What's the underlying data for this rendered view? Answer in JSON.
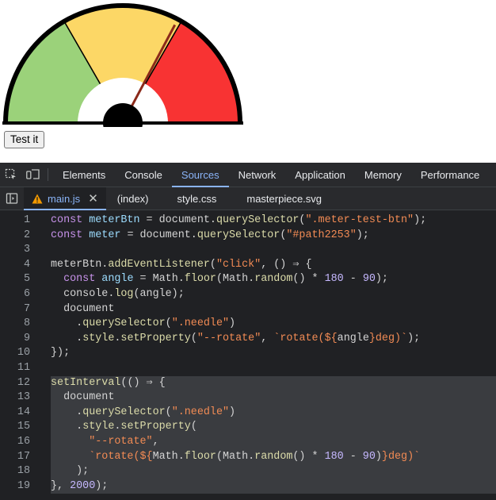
{
  "gauge": {
    "needle_angle_deg": 28,
    "colors": {
      "green": "#9bd27a",
      "yellow": "#fcd766",
      "red": "#f83333",
      "needle": "#8b2a1a",
      "outline": "#000000"
    }
  },
  "button": {
    "label": "Test it"
  },
  "devtools": {
    "tabs": [
      "Elements",
      "Console",
      "Sources",
      "Network",
      "Application",
      "Memory",
      "Performance"
    ],
    "active_tab": "Sources",
    "files": [
      "main.js",
      "(index)",
      "style.css",
      "masterpiece.svg"
    ],
    "active_file": "main.js",
    "line_numbers": [
      "1",
      "2",
      "3",
      "4",
      "5",
      "6",
      "7",
      "8",
      "9",
      "10",
      "11",
      "12",
      "13",
      "14",
      "15",
      "16",
      "17",
      "18",
      "19"
    ],
    "highlighted_lines": [
      12,
      13,
      14,
      15,
      16,
      17,
      18,
      19
    ]
  },
  "code": [
    [
      [
        "kw2",
        "const "
      ],
      [
        "vr",
        "meterBtn"
      ],
      [
        "pl",
        " = "
      ],
      [
        "pl",
        "document."
      ],
      [
        "fn",
        "querySelector"
      ],
      [
        "pl",
        "("
      ],
      [
        "st",
        "\".meter-test-btn\""
      ],
      [
        "pl",
        ");"
      ]
    ],
    [
      [
        "kw2",
        "const "
      ],
      [
        "vr",
        "meter"
      ],
      [
        "pl",
        " = "
      ],
      [
        "pl",
        "document."
      ],
      [
        "fn",
        "querySelector"
      ],
      [
        "pl",
        "("
      ],
      [
        "st",
        "\"#path2253\""
      ],
      [
        "pl",
        ");"
      ]
    ],
    [],
    [
      [
        "pl",
        "meterBtn."
      ],
      [
        "fn",
        "addEventListener"
      ],
      [
        "pl",
        "("
      ],
      [
        "st",
        "\"click\""
      ],
      [
        "pl",
        ", () ⇒ {"
      ]
    ],
    [
      [
        "pl",
        "  "
      ],
      [
        "kw2",
        "const "
      ],
      [
        "vr",
        "angle"
      ],
      [
        "pl",
        " = Math."
      ],
      [
        "fn",
        "floor"
      ],
      [
        "pl",
        "(Math."
      ],
      [
        "fn",
        "random"
      ],
      [
        "pl",
        "() "
      ],
      [
        "pl",
        "* "
      ],
      [
        "nm",
        "180"
      ],
      [
        "pl",
        " - "
      ],
      [
        "nm",
        "90"
      ],
      [
        "pl",
        ");"
      ]
    ],
    [
      [
        "pl",
        "  console."
      ],
      [
        "fn",
        "log"
      ],
      [
        "pl",
        "(angle);"
      ]
    ],
    [
      [
        "pl",
        "  document"
      ]
    ],
    [
      [
        "pl",
        "    ."
      ],
      [
        "fn",
        "querySelector"
      ],
      [
        "pl",
        "("
      ],
      [
        "st",
        "\".needle\""
      ],
      [
        "pl",
        ")"
      ]
    ],
    [
      [
        "pl",
        "    ."
      ],
      [
        "fn",
        "style"
      ],
      [
        "pl",
        "."
      ],
      [
        "fn",
        "setProperty"
      ],
      [
        "pl",
        "("
      ],
      [
        "st",
        "\"--rotate\""
      ],
      [
        "pl",
        ", "
      ],
      [
        "st",
        "`rotate(${"
      ],
      [
        "pl",
        "angle"
      ],
      [
        "st",
        "}deg)`"
      ],
      [
        "pl",
        ");"
      ]
    ],
    [
      [
        "pl",
        "});"
      ]
    ],
    [],
    [
      [
        "fn",
        "setInterval"
      ],
      [
        "pl",
        "(() ⇒ {"
      ]
    ],
    [
      [
        "pl",
        "  document"
      ]
    ],
    [
      [
        "pl",
        "    ."
      ],
      [
        "fn",
        "querySelector"
      ],
      [
        "pl",
        "("
      ],
      [
        "st",
        "\".needle\""
      ],
      [
        "pl",
        ")"
      ]
    ],
    [
      [
        "pl",
        "    ."
      ],
      [
        "fn",
        "style"
      ],
      [
        "pl",
        "."
      ],
      [
        "fn",
        "setProperty"
      ],
      [
        "pl",
        "("
      ]
    ],
    [
      [
        "pl",
        "      "
      ],
      [
        "st",
        "\"--rotate\""
      ],
      [
        "pl",
        ","
      ]
    ],
    [
      [
        "pl",
        "      "
      ],
      [
        "st",
        "`rotate(${"
      ],
      [
        "pl",
        "Math."
      ],
      [
        "fn",
        "floor"
      ],
      [
        "pl",
        "(Math."
      ],
      [
        "fn",
        "random"
      ],
      [
        "pl",
        "() * "
      ],
      [
        "nm",
        "180"
      ],
      [
        "pl",
        " - "
      ],
      [
        "nm",
        "90"
      ],
      [
        "pl",
        ")"
      ],
      [
        "st",
        "}deg)`"
      ]
    ],
    [
      [
        "pl",
        "    );"
      ]
    ],
    [
      [
        "pl",
        "}, "
      ],
      [
        "nm",
        "2000"
      ],
      [
        "pl",
        ");"
      ]
    ]
  ]
}
